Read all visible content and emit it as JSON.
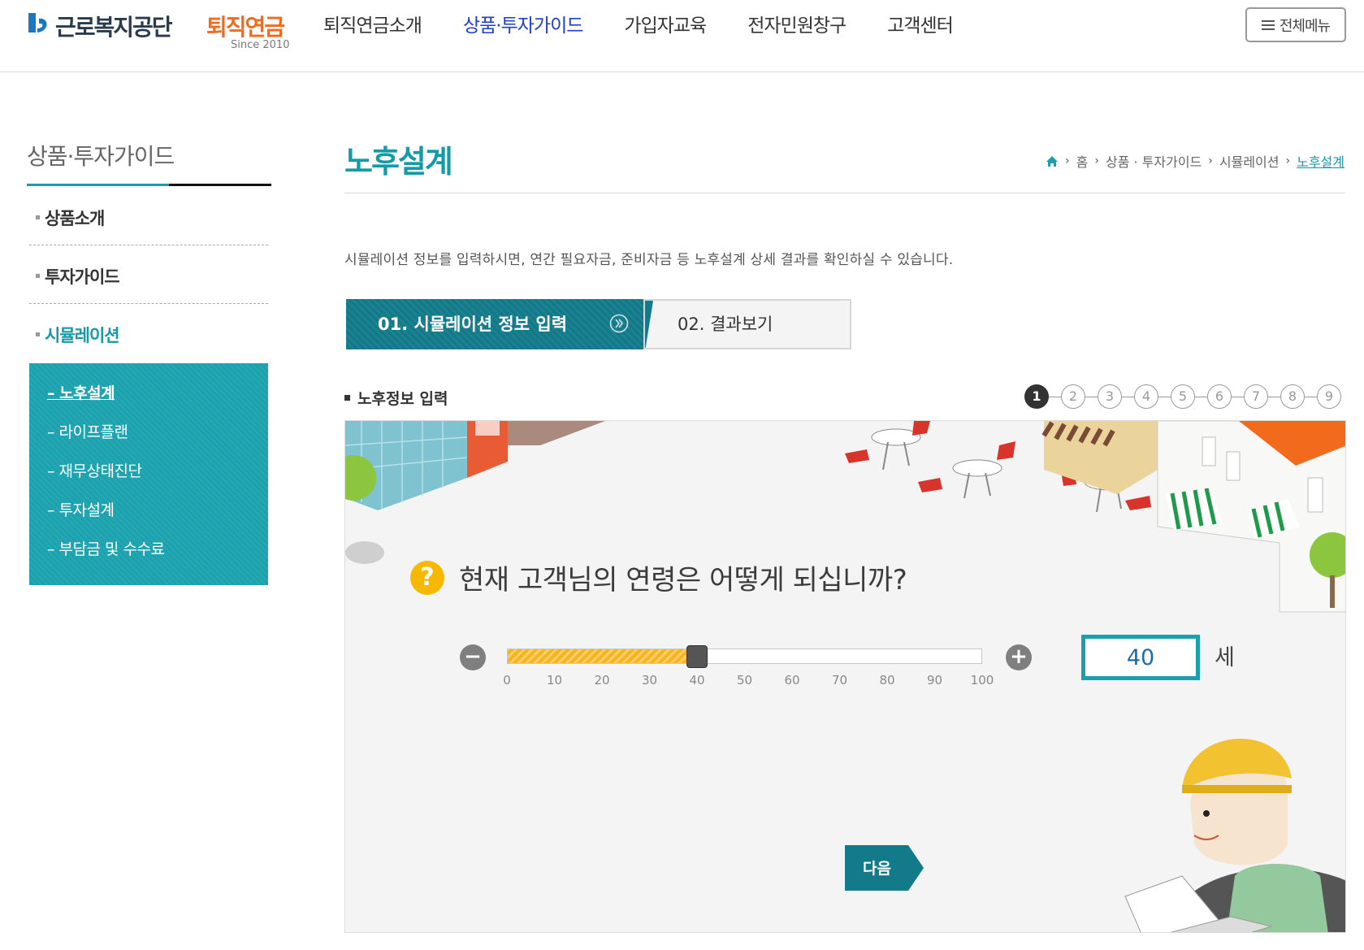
{
  "header": {
    "logo_org": "근로복지공단",
    "logo_product": "퇴직연금",
    "logo_since": "Since 2010",
    "nav": [
      {
        "label": "퇴직연금소개",
        "active": false
      },
      {
        "label": "상품·투자가이드",
        "active": true
      },
      {
        "label": "가입자교육",
        "active": false
      },
      {
        "label": "전자민원창구",
        "active": false
      },
      {
        "label": "고객센터",
        "active": false
      }
    ],
    "all_menu_label": "전체메뉴"
  },
  "sidebar": {
    "title": "상품·투자가이드",
    "items": [
      {
        "label": "상품소개"
      },
      {
        "label": "투자가이드"
      },
      {
        "label": "시뮬레이션"
      }
    ],
    "subitems": [
      {
        "label": "노후설계"
      },
      {
        "label": "라이프플랜"
      },
      {
        "label": "재무상태진단"
      },
      {
        "label": "투자설계"
      },
      {
        "label": "부담금 및 수수료"
      }
    ]
  },
  "content": {
    "title": "노후설계",
    "breadcrumb": [
      "홈",
      "상품 · 투자가이드",
      "시뮬레이션",
      "노후설계"
    ],
    "description": "시뮬레이션 정보를 입력하시면, 연간 필요자금, 준비자금 등 노후설계 상세 결과를 확인하실 수 있습니다.",
    "steps": [
      {
        "label": "01. 시뮬레이션 정보 입력"
      },
      {
        "label": "02. 결과보기"
      }
    ],
    "section_title": "노후정보 입력",
    "pages": [
      "1",
      "2",
      "3",
      "4",
      "5",
      "6",
      "7",
      "8",
      "9"
    ],
    "current_page": 1
  },
  "question": {
    "icon_text": "?",
    "text": "현재 고객님의 연령은 어떻게 되십니까?",
    "minus_label": "−",
    "plus_label": "+",
    "slider": {
      "min": 0,
      "max": 100,
      "value": 40
    },
    "ticks": [
      "0",
      "10",
      "20",
      "30",
      "40",
      "50",
      "60",
      "70",
      "80",
      "90",
      "100"
    ],
    "age_value": "40",
    "unit": "세",
    "next_label": "다음"
  },
  "colors": {
    "accent": "#1a9fac",
    "nav_active": "#1e3fc8",
    "step_active": "#137a8a",
    "slider_fill": "#f7b41c",
    "logo_orange": "#f26b1d",
    "next_button": "#137a8a"
  }
}
